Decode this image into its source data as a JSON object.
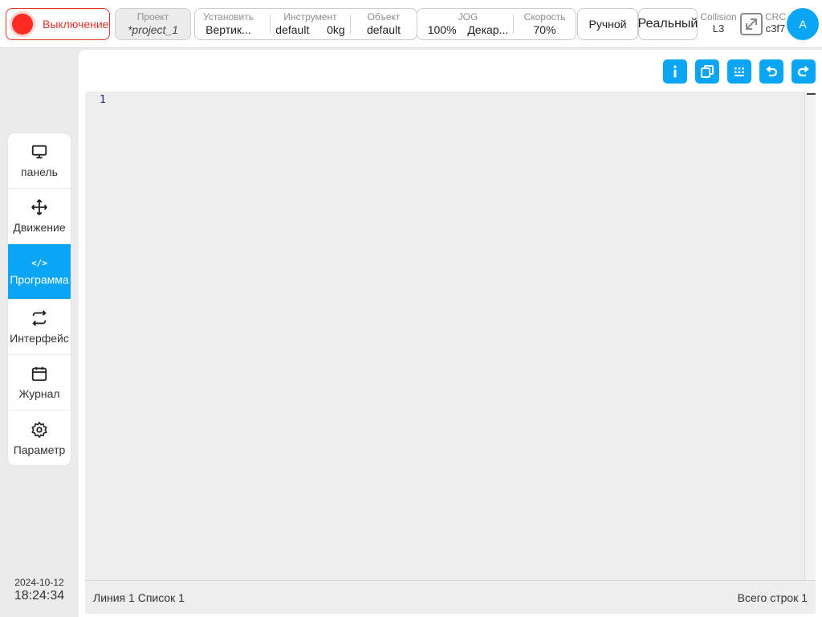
{
  "topbar": {
    "power": {
      "label": "Выключение",
      "color": "#ff2b22"
    },
    "project": {
      "key": "Проект",
      "value": "*project_1"
    },
    "install": {
      "key": "Установить",
      "value": "Вертик..."
    },
    "tool": {
      "key": "Инструмент",
      "value": "default",
      "load": "0kg"
    },
    "object": {
      "key": "Объект",
      "value": "default"
    },
    "jog": {
      "key": "JOG",
      "value": "100%",
      "mode": "Декар..."
    },
    "speed": {
      "key": "Скорость",
      "value": "70%"
    },
    "manual_label": "Ручной",
    "real_label": "Реальный",
    "collision": {
      "key": "Collision",
      "value": "L3"
    },
    "crc": {
      "key": "CRC",
      "value": "c3f7"
    },
    "expand_icon": "expand-icon",
    "avatar_label": "A"
  },
  "sidebar": {
    "items": [
      {
        "label": "панель",
        "icon": "monitor-icon"
      },
      {
        "label": "Движение",
        "icon": "move-icon"
      },
      {
        "label": "Программа",
        "icon": "code-icon",
        "glyph": "</>"
      },
      {
        "label": "Интерфейс",
        "icon": "swap-icon"
      },
      {
        "label": "Журнал",
        "icon": "calendar-icon"
      },
      {
        "label": "Параметр",
        "icon": "gear-icon"
      }
    ],
    "active_index": 2
  },
  "clock": {
    "date": "2024-10-12",
    "time": "18:24:34"
  },
  "toolbar": {
    "buttons": [
      "info-icon",
      "copy-icon",
      "keyboard-icon",
      "undo-icon",
      "redo-icon"
    ]
  },
  "editor": {
    "line_numbers": [
      "1"
    ]
  },
  "status": {
    "position": "Линия 1 Список 1",
    "total_lines": "Всего строк 1"
  },
  "colors": {
    "accent": "#0aa6f5",
    "danger": "#e0352b",
    "editor_bg": "#eeeeee"
  }
}
